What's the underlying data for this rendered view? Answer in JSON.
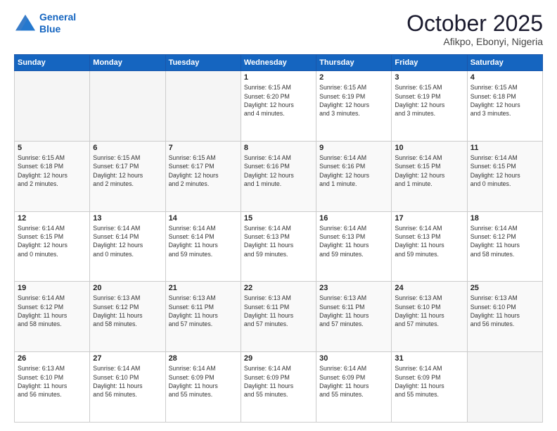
{
  "header": {
    "logo_line1": "General",
    "logo_line2": "Blue",
    "month": "October 2025",
    "location": "Afikpo, Ebonyi, Nigeria"
  },
  "weekdays": [
    "Sunday",
    "Monday",
    "Tuesday",
    "Wednesday",
    "Thursday",
    "Friday",
    "Saturday"
  ],
  "weeks": [
    [
      {
        "day": "",
        "info": ""
      },
      {
        "day": "",
        "info": ""
      },
      {
        "day": "",
        "info": ""
      },
      {
        "day": "1",
        "info": "Sunrise: 6:15 AM\nSunset: 6:20 PM\nDaylight: 12 hours\nand 4 minutes."
      },
      {
        "day": "2",
        "info": "Sunrise: 6:15 AM\nSunset: 6:19 PM\nDaylight: 12 hours\nand 3 minutes."
      },
      {
        "day": "3",
        "info": "Sunrise: 6:15 AM\nSunset: 6:19 PM\nDaylight: 12 hours\nand 3 minutes."
      },
      {
        "day": "4",
        "info": "Sunrise: 6:15 AM\nSunset: 6:18 PM\nDaylight: 12 hours\nand 3 minutes."
      }
    ],
    [
      {
        "day": "5",
        "info": "Sunrise: 6:15 AM\nSunset: 6:18 PM\nDaylight: 12 hours\nand 2 minutes."
      },
      {
        "day": "6",
        "info": "Sunrise: 6:15 AM\nSunset: 6:17 PM\nDaylight: 12 hours\nand 2 minutes."
      },
      {
        "day": "7",
        "info": "Sunrise: 6:15 AM\nSunset: 6:17 PM\nDaylight: 12 hours\nand 2 minutes."
      },
      {
        "day": "8",
        "info": "Sunrise: 6:14 AM\nSunset: 6:16 PM\nDaylight: 12 hours\nand 1 minute."
      },
      {
        "day": "9",
        "info": "Sunrise: 6:14 AM\nSunset: 6:16 PM\nDaylight: 12 hours\nand 1 minute."
      },
      {
        "day": "10",
        "info": "Sunrise: 6:14 AM\nSunset: 6:15 PM\nDaylight: 12 hours\nand 1 minute."
      },
      {
        "day": "11",
        "info": "Sunrise: 6:14 AM\nSunset: 6:15 PM\nDaylight: 12 hours\nand 0 minutes."
      }
    ],
    [
      {
        "day": "12",
        "info": "Sunrise: 6:14 AM\nSunset: 6:15 PM\nDaylight: 12 hours\nand 0 minutes."
      },
      {
        "day": "13",
        "info": "Sunrise: 6:14 AM\nSunset: 6:14 PM\nDaylight: 12 hours\nand 0 minutes."
      },
      {
        "day": "14",
        "info": "Sunrise: 6:14 AM\nSunset: 6:14 PM\nDaylight: 11 hours\nand 59 minutes."
      },
      {
        "day": "15",
        "info": "Sunrise: 6:14 AM\nSunset: 6:13 PM\nDaylight: 11 hours\nand 59 minutes."
      },
      {
        "day": "16",
        "info": "Sunrise: 6:14 AM\nSunset: 6:13 PM\nDaylight: 11 hours\nand 59 minutes."
      },
      {
        "day": "17",
        "info": "Sunrise: 6:14 AM\nSunset: 6:13 PM\nDaylight: 11 hours\nand 59 minutes."
      },
      {
        "day": "18",
        "info": "Sunrise: 6:14 AM\nSunset: 6:12 PM\nDaylight: 11 hours\nand 58 minutes."
      }
    ],
    [
      {
        "day": "19",
        "info": "Sunrise: 6:14 AM\nSunset: 6:12 PM\nDaylight: 11 hours\nand 58 minutes."
      },
      {
        "day": "20",
        "info": "Sunrise: 6:13 AM\nSunset: 6:12 PM\nDaylight: 11 hours\nand 58 minutes."
      },
      {
        "day": "21",
        "info": "Sunrise: 6:13 AM\nSunset: 6:11 PM\nDaylight: 11 hours\nand 57 minutes."
      },
      {
        "day": "22",
        "info": "Sunrise: 6:13 AM\nSunset: 6:11 PM\nDaylight: 11 hours\nand 57 minutes."
      },
      {
        "day": "23",
        "info": "Sunrise: 6:13 AM\nSunset: 6:11 PM\nDaylight: 11 hours\nand 57 minutes."
      },
      {
        "day": "24",
        "info": "Sunrise: 6:13 AM\nSunset: 6:10 PM\nDaylight: 11 hours\nand 57 minutes."
      },
      {
        "day": "25",
        "info": "Sunrise: 6:13 AM\nSunset: 6:10 PM\nDaylight: 11 hours\nand 56 minutes."
      }
    ],
    [
      {
        "day": "26",
        "info": "Sunrise: 6:13 AM\nSunset: 6:10 PM\nDaylight: 11 hours\nand 56 minutes."
      },
      {
        "day": "27",
        "info": "Sunrise: 6:14 AM\nSunset: 6:10 PM\nDaylight: 11 hours\nand 56 minutes."
      },
      {
        "day": "28",
        "info": "Sunrise: 6:14 AM\nSunset: 6:09 PM\nDaylight: 11 hours\nand 55 minutes."
      },
      {
        "day": "29",
        "info": "Sunrise: 6:14 AM\nSunset: 6:09 PM\nDaylight: 11 hours\nand 55 minutes."
      },
      {
        "day": "30",
        "info": "Sunrise: 6:14 AM\nSunset: 6:09 PM\nDaylight: 11 hours\nand 55 minutes."
      },
      {
        "day": "31",
        "info": "Sunrise: 6:14 AM\nSunset: 6:09 PM\nDaylight: 11 hours\nand 55 minutes."
      },
      {
        "day": "",
        "info": ""
      }
    ]
  ]
}
